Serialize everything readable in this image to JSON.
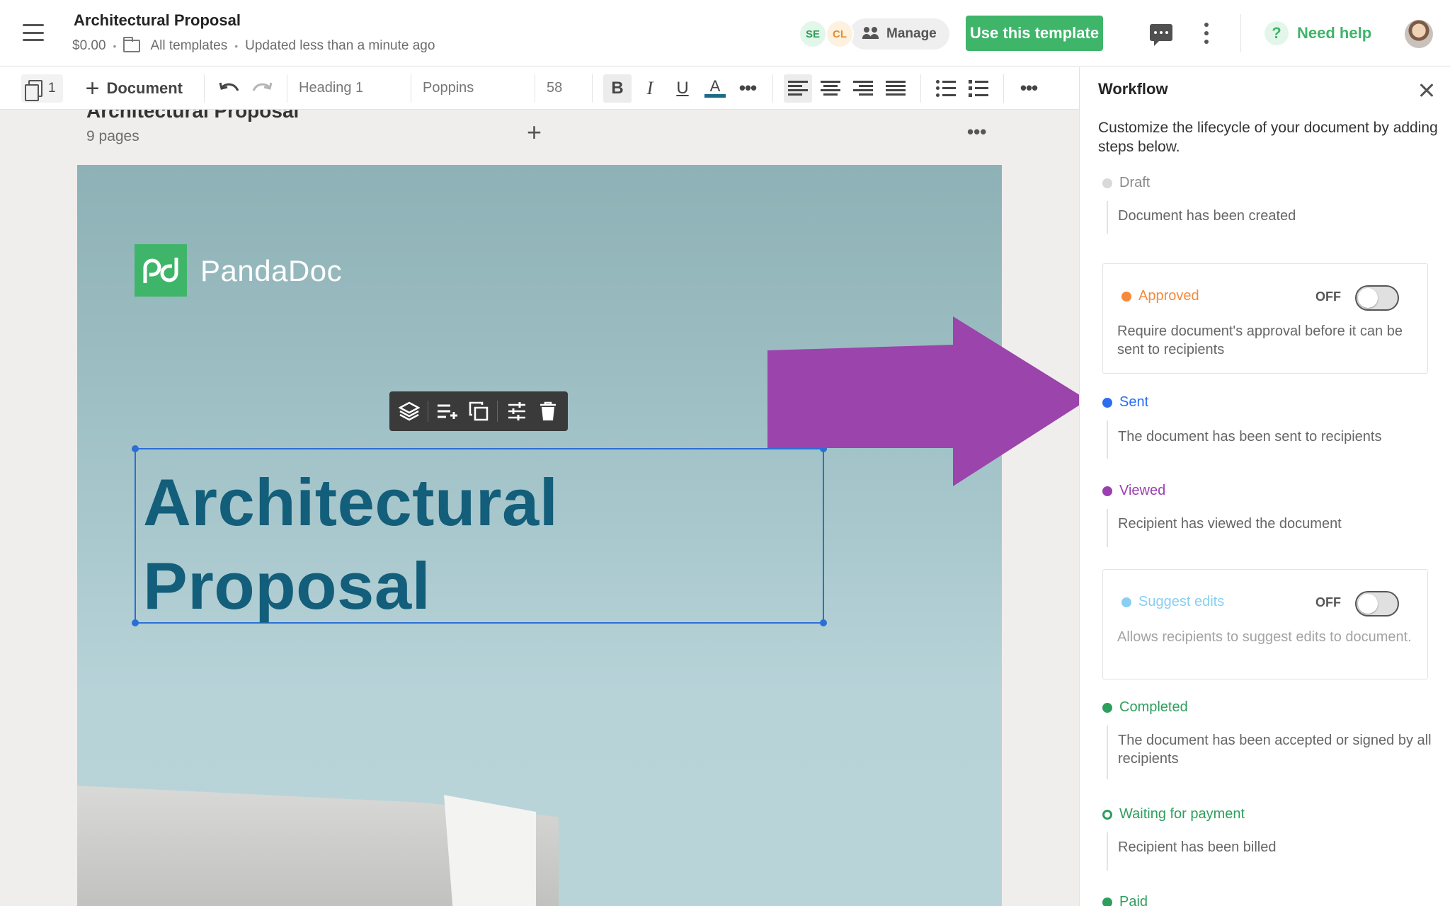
{
  "header": {
    "title": "Architectural Proposal",
    "price": "$0.00",
    "folder": "All templates",
    "updated": "Updated less than a minute ago",
    "collaborators": [
      "SE",
      "CL"
    ],
    "manage_label": "Manage",
    "use_template_label": "Use this template",
    "help_label": "Need help",
    "help_glyph": "?"
  },
  "toolbar": {
    "page_count": "1",
    "add_document_label": "Document",
    "style": "Heading 1",
    "font": "Poppins",
    "font_size": "58",
    "bold": "B",
    "italic": "I",
    "underline": "U",
    "color_letter": "A",
    "text_color": "#1a6b87"
  },
  "canvas": {
    "prev_title": "Architectural Proposal",
    "pages_count": "9 pages",
    "logo_text": "PandaDoc",
    "heading_line1": "Architectural",
    "heading_line2": "Proposal",
    "heading_color": "#135e7a",
    "arrow_color": "#9b44ab"
  },
  "workflow": {
    "title": "Workflow",
    "description": "Customize the lifecycle of your document by adding steps below.",
    "steps": [
      {
        "label": "Draft",
        "description": "Document has been created",
        "color": "#d9d9d9"
      },
      {
        "label": "Approved",
        "description": "Require document's approval before it can be sent to recipients",
        "color": "#f58a3c",
        "toggle": "OFF"
      },
      {
        "label": "Sent",
        "description": "The document has been sent to recipients",
        "color": "#2a6ff0"
      },
      {
        "label": "Viewed",
        "description": "Recipient has viewed the document",
        "color": "#9b3fb0"
      },
      {
        "label": "Suggest edits",
        "description": "Allows recipients to suggest edits to document.",
        "color": "#6cc3ee",
        "toggle": "OFF"
      },
      {
        "label": "Completed",
        "description": "The document has been accepted or signed by all recipients",
        "color": "#2e9e5d"
      },
      {
        "label": "Waiting for payment",
        "description": "Recipient has been billed",
        "color": "#2e9e5d"
      },
      {
        "label": "Paid",
        "color": "#2e9e5d"
      }
    ]
  }
}
